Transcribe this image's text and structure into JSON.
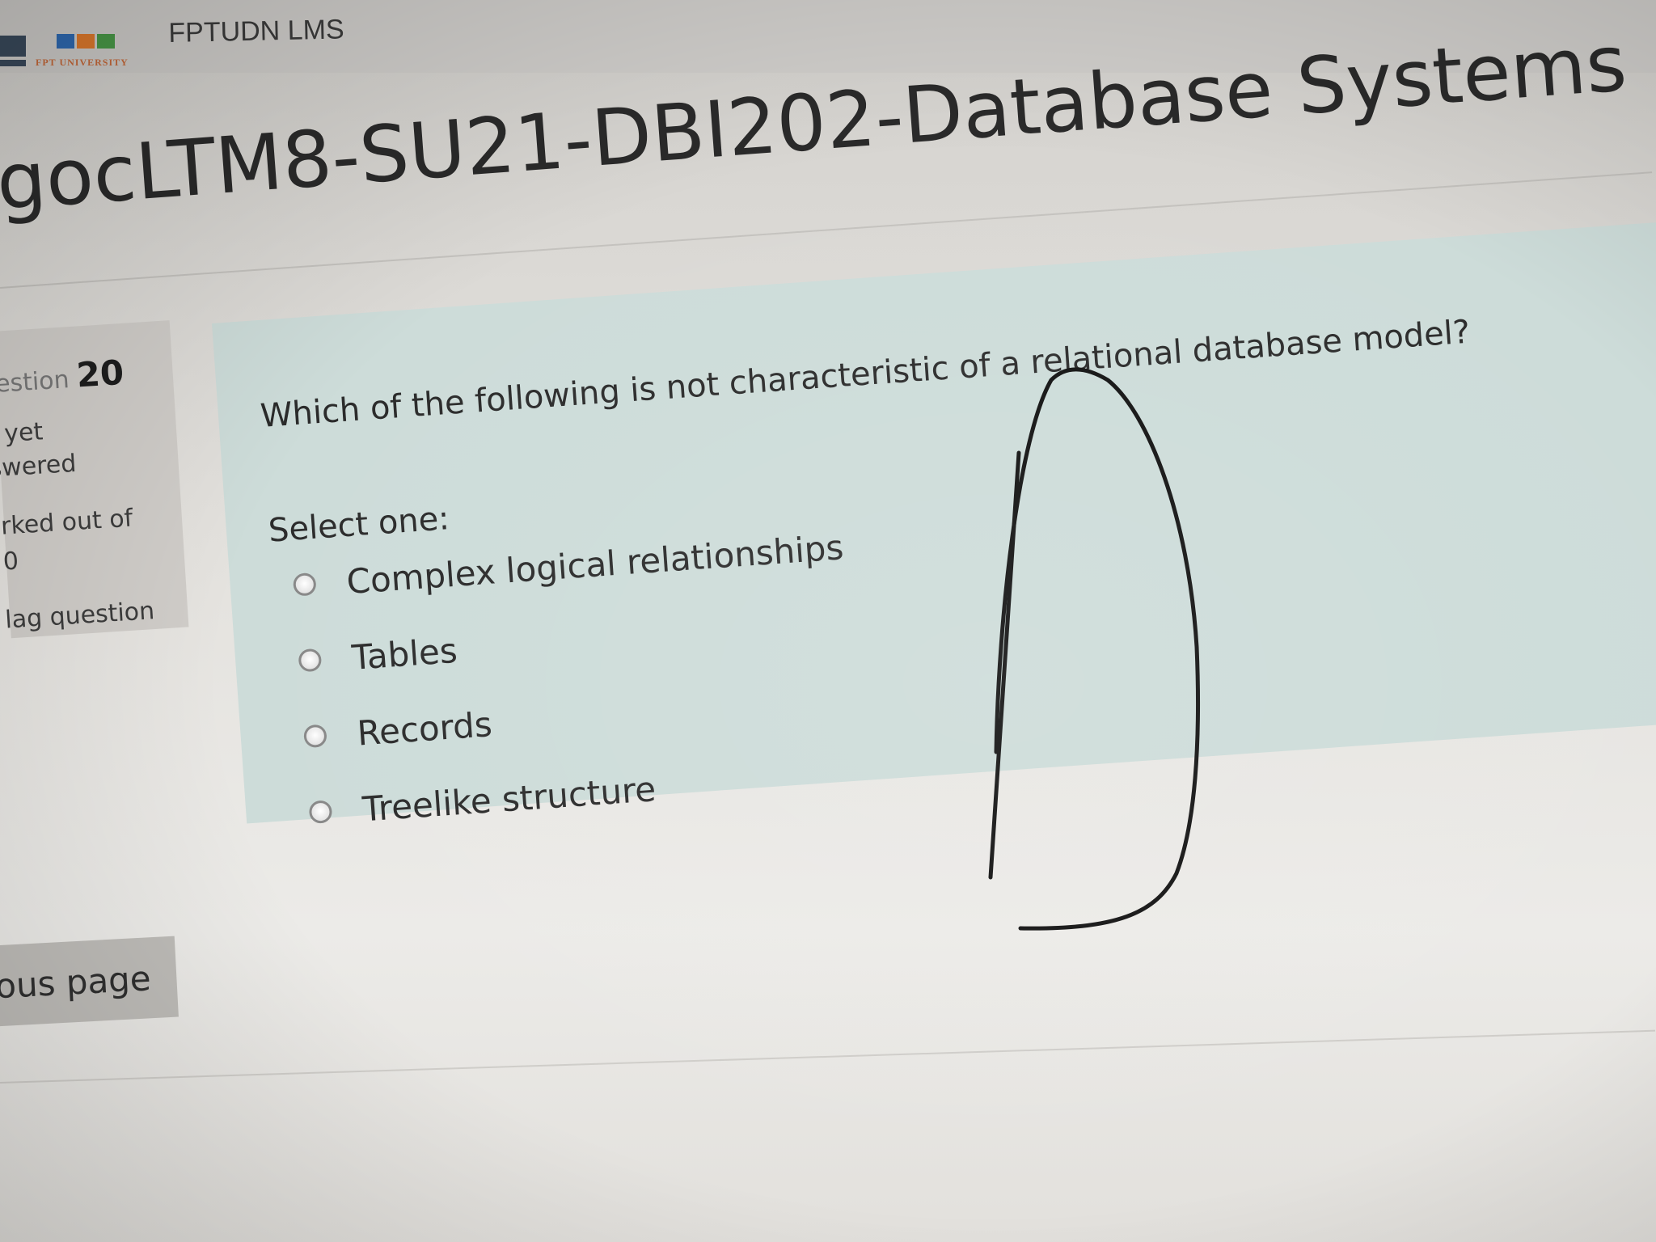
{
  "header": {
    "site_name": "FPTUDN LMS",
    "logo_subtext": "FPT UNIVERSITY"
  },
  "course": {
    "title": "gocLTM8-SU21-DBI202-Database Systems"
  },
  "question_info": {
    "label_prefix": "estion",
    "number": "20",
    "status_line1": "t yet",
    "status_line2": "swered",
    "marked_line1": "rked out of",
    "marked_line2": "0",
    "flag_label": "lag question"
  },
  "question": {
    "text": "Which of the following is not characteristic of a relational database model?",
    "select_label": "Select one:",
    "options": [
      {
        "label": "Complex logical relationships",
        "selected": false
      },
      {
        "label": "Tables",
        "selected": false
      },
      {
        "label": "Records",
        "selected": false
      },
      {
        "label": "Treelike structure",
        "selected": false
      }
    ]
  },
  "navigation": {
    "prev_label": "ious page"
  },
  "annotation": {
    "handwritten_letter": "D"
  },
  "colors": {
    "panel_bg": "#cddcd9",
    "info_bg": "#d0cdc9",
    "button_bg": "#bebcb8",
    "logo_orange": "#c86a3a"
  }
}
